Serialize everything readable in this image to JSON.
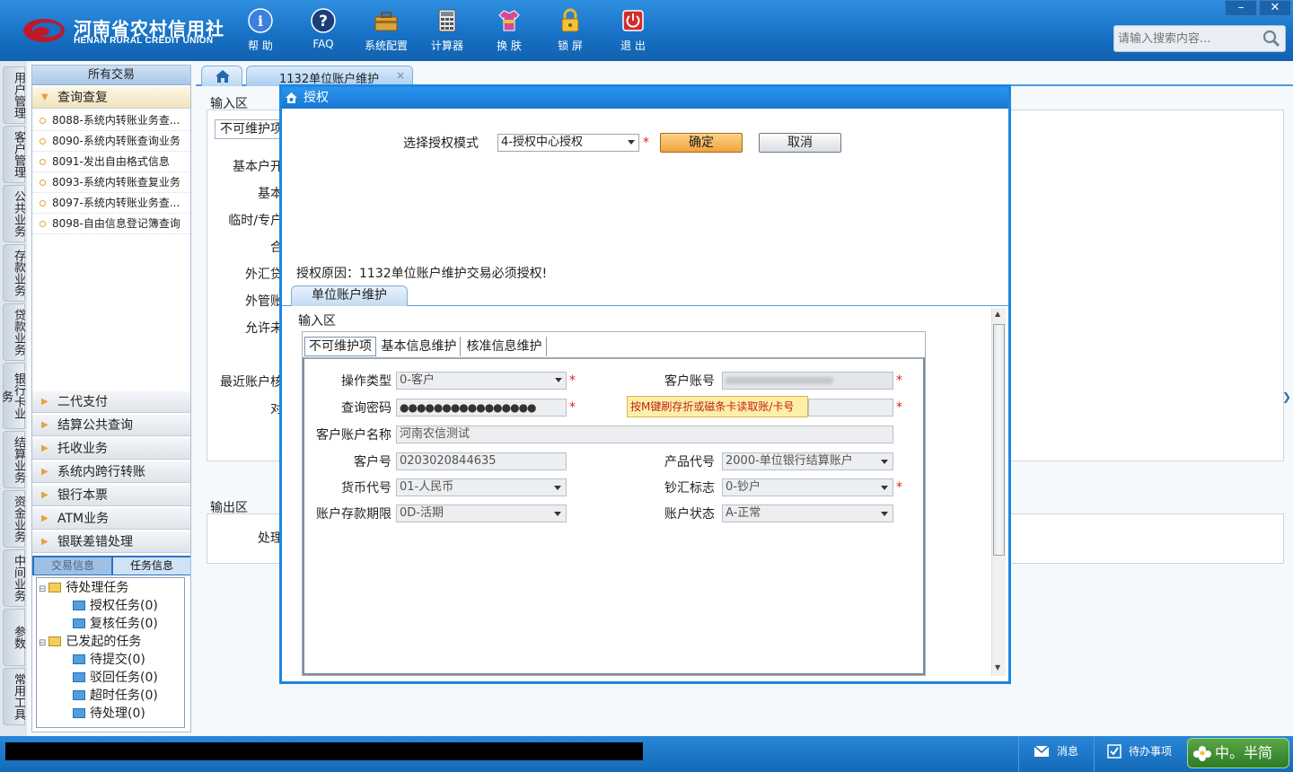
{
  "header": {
    "logo_cn": "河南省农村信用社",
    "logo_en": "HENAN RURAL CREDIT UNION",
    "toolbar": [
      {
        "label": "帮 助",
        "icon": "info-icon"
      },
      {
        "label": "FAQ",
        "icon": "question-icon"
      },
      {
        "label": "系统配置",
        "icon": "toolbox-icon"
      },
      {
        "label": "计算器",
        "icon": "calculator-icon"
      },
      {
        "label": "换 肤",
        "icon": "shirt-icon"
      },
      {
        "label": "锁 屏",
        "icon": "lock-icon"
      },
      {
        "label": "退 出",
        "icon": "power-icon"
      }
    ],
    "window_controls": {
      "minimize": "–",
      "close": "✕"
    },
    "search_placeholder": "请输入搜索内容..."
  },
  "vertical_tabs": [
    "用户管理",
    "客户管理",
    "公共业务",
    "存款业务",
    "贷款业务",
    "银行卡业务",
    "结算业务",
    "资金业务",
    "中间业务",
    "参数",
    "常用工具"
  ],
  "nav": {
    "header": "所有交易",
    "open_group": "查询查复",
    "items": [
      "8088-系统内转账业务查...",
      "8090-系统内转账查询业务",
      "8091-发出自由格式信息",
      "8093-系统内转账查复业务",
      "8097-系统内转账业务查...",
      "8098-自由信息登记簿查询"
    ],
    "groups": [
      "二代支付",
      "结算公共查询",
      "托收业务",
      "系统内跨行转账",
      "银行本票",
      "ATM业务",
      "银联差错处理"
    ],
    "task_tabs": [
      "交易信息",
      "任务信息"
    ],
    "tree": {
      "pending": "待处理任务",
      "pending_children": [
        "授权任务(0)",
        "复核任务(0)"
      ],
      "initiated": "已发起的任务",
      "initiated_children": [
        "待提交(0)",
        "驳回任务(0)",
        "超时任务(0)",
        "待处理(0)"
      ]
    }
  },
  "main": {
    "tab_label": "1132单位账户维护",
    "tab_close": "×",
    "input_area": "输入区",
    "bg_tab": "不可维护项",
    "bg_labels": [
      "基本户开",
      "基本",
      "临时/专户",
      "合",
      "外汇贷",
      "外管账",
      "允许未",
      "最近账户核",
      "对"
    ],
    "output_area": "输出区",
    "output_label": "处理"
  },
  "dialog": {
    "title": "授权",
    "mode_label": "选择授权模式",
    "mode_value": "4-授权中心授权",
    "confirm": "确定",
    "cancel": "取消",
    "reason": "授权原因：1132单位账户维护交易必须授权!",
    "inner_tab": "单位账户维护",
    "input_area": "输入区",
    "subtabs": [
      "不可维护项",
      "基本信息维护",
      "核准信息维护"
    ],
    "form": {
      "op_type_label": "操作类型",
      "op_type_value": "0-客户",
      "acct_no_label": "客户账号",
      "query_pwd_label": "查询密码",
      "query_pwd_value": "●●●●●●●●●●●●●●●●",
      "tooltip": "按M键刷存折或磁条卡读取账/卡号",
      "acct_name_label": "客户账户名称",
      "acct_name_value": "河南农信测试",
      "cust_no_label": "客户号",
      "cust_no_value": "0203020844635",
      "product_label": "产品代号",
      "product_value": "2000-单位银行结算账户",
      "currency_label": "货币代号",
      "currency_value": "01-人民币",
      "cash_label": "钞汇标志",
      "cash_value": "0-钞户",
      "term_label": "账户存款期限",
      "term_value": "0D-活期",
      "status_label": "账户状态",
      "status_value": "A-正常"
    }
  },
  "statusbar": {
    "message": "消息",
    "todo": "待办事项",
    "ime": "中。半简"
  }
}
